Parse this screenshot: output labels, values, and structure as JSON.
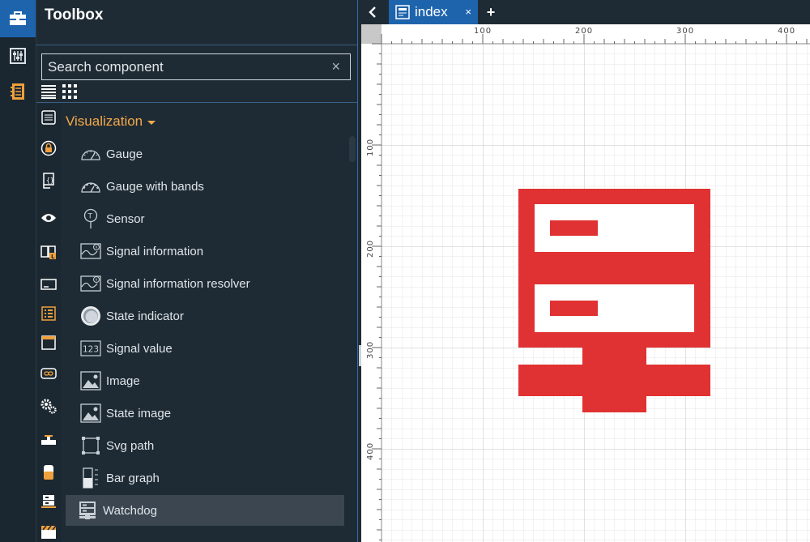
{
  "toolbox": {
    "title": "Toolbox",
    "search_placeholder": "Search component",
    "clear_symbol": "×"
  },
  "group": {
    "title": "Visualization"
  },
  "items": [
    {
      "label": "Gauge",
      "icon": "gauge-icon"
    },
    {
      "label": "Gauge with bands",
      "icon": "gauge-bands-icon"
    },
    {
      "label": "Sensor",
      "icon": "sensor-icon"
    },
    {
      "label": "Signal information",
      "icon": "signal-info-icon"
    },
    {
      "label": "Signal information resolver",
      "icon": "signal-info-resolver-icon"
    },
    {
      "label": "State indicator",
      "icon": "state-indicator-icon"
    },
    {
      "label": "Signal value",
      "icon": "signal-value-icon"
    },
    {
      "label": "Image",
      "icon": "image-icon"
    },
    {
      "label": "State image",
      "icon": "state-image-icon"
    },
    {
      "label": "Svg path",
      "icon": "svg-path-icon"
    },
    {
      "label": "Bar graph",
      "icon": "bar-graph-icon"
    },
    {
      "label": "Watchdog",
      "icon": "watchdog-icon"
    }
  ],
  "selected_item": "Watchdog",
  "tab": {
    "label": "index",
    "close_symbol": "×",
    "add_symbol": "+"
  },
  "ruler": {
    "h_labels": [
      "100",
      "200",
      "300",
      "400"
    ],
    "v_labels": [
      "100",
      "200",
      "300",
      "400"
    ]
  },
  "colors": {
    "accent": "#1e64ad",
    "group_title": "#f5a94a",
    "watchdog": "#e03232",
    "background": "#1f2b34"
  }
}
